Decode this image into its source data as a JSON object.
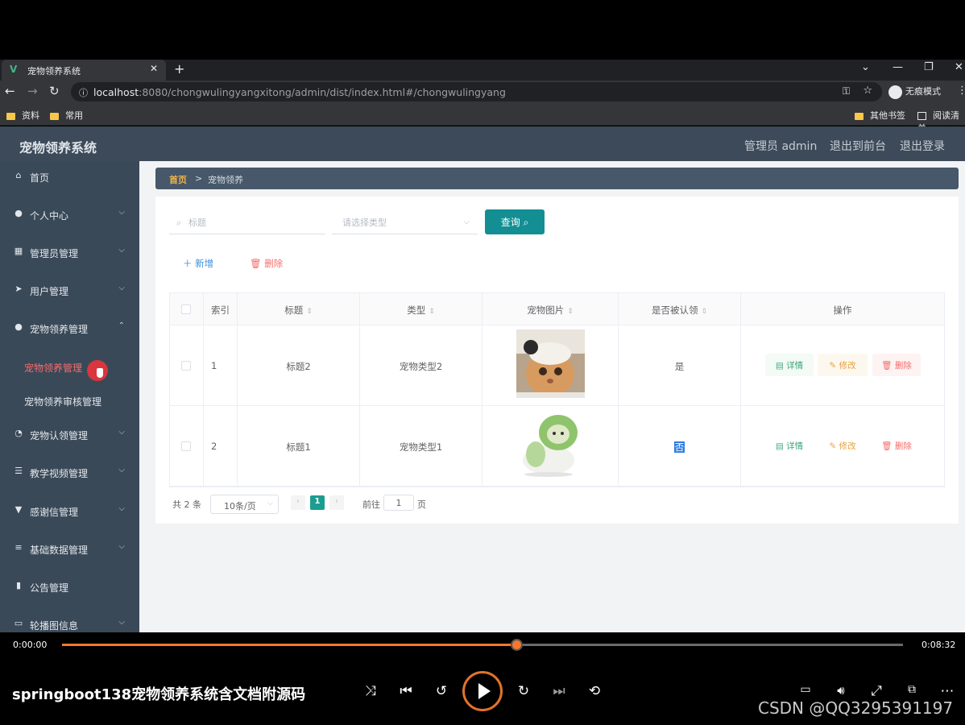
{
  "browser": {
    "tab_title": "宠物领养系统",
    "url_host": "localhost",
    "url_rest": ":8080/chongwulingyangxitong/admin/dist/index.html#/chongwulingyang",
    "incognito_label": "无痕模式",
    "bookmarks": [
      "资料",
      "常用"
    ],
    "bookmarks_right": [
      "其他书签",
      "阅读清单"
    ]
  },
  "app": {
    "title": "宠物领养系统",
    "header_links": [
      "管理员 admin",
      "退出到前台",
      "退出登录"
    ]
  },
  "sidebar": {
    "items": [
      {
        "label": "首页",
        "icon": "home-icon",
        "expandable": false
      },
      {
        "label": "个人中心",
        "icon": "user-icon",
        "expandable": true
      },
      {
        "label": "管理员管理",
        "icon": "grid-icon",
        "expandable": true
      },
      {
        "label": "用户管理",
        "icon": "send-icon",
        "expandable": true
      },
      {
        "label": "宠物领养管理",
        "icon": "user-icon",
        "expandable": true,
        "expanded": true
      },
      {
        "label": "宠物认领管理",
        "icon": "compass-icon",
        "expandable": true
      },
      {
        "label": "教学视频管理",
        "icon": "sliders-icon",
        "expandable": true
      },
      {
        "label": "感谢信管理",
        "icon": "sign-icon",
        "expandable": true
      },
      {
        "label": "基础数据管理",
        "icon": "list-icon",
        "expandable": true
      },
      {
        "label": "公告管理",
        "icon": "chart-icon",
        "expandable": false
      },
      {
        "label": "轮播图信息",
        "icon": "image-icon",
        "expandable": true
      }
    ],
    "sub_items": [
      {
        "label": "宠物领养管理",
        "active": true
      },
      {
        "label": "宠物领养审核管理",
        "active": false
      }
    ]
  },
  "breadcrumb": {
    "home": "首页",
    "separator": ">",
    "current": "宠物领养"
  },
  "search": {
    "title_placeholder": "标题",
    "type_placeholder": "请选择类型",
    "query_label": "查询"
  },
  "actions": {
    "add_label": "新增",
    "delete_label": "删除"
  },
  "table": {
    "headers": [
      "索引",
      "标题",
      "类型",
      "宠物图片",
      "是否被认领",
      "操作"
    ],
    "rows": [
      {
        "index": "1",
        "title": "标题2",
        "type": "宠物类型2",
        "claimed": "是"
      },
      {
        "index": "2",
        "title": "标题1",
        "type": "宠物类型1",
        "claimed": "否"
      }
    ],
    "op_labels": {
      "detail": "详情",
      "edit": "修改",
      "delete": "删除"
    }
  },
  "pagination": {
    "total": "共 2 条",
    "page_size": "10条/页",
    "current_page": "1",
    "goto_label": "前往",
    "goto_value": "1",
    "page_unit": "页"
  },
  "player": {
    "current_time": "0:00:00",
    "duration": "0:08:32",
    "progress": 0.54,
    "title": "springboot138宠物领养系统含文档附源码",
    "watermark": "CSDN @QQ3295391197",
    "accent": "#f4772c"
  }
}
